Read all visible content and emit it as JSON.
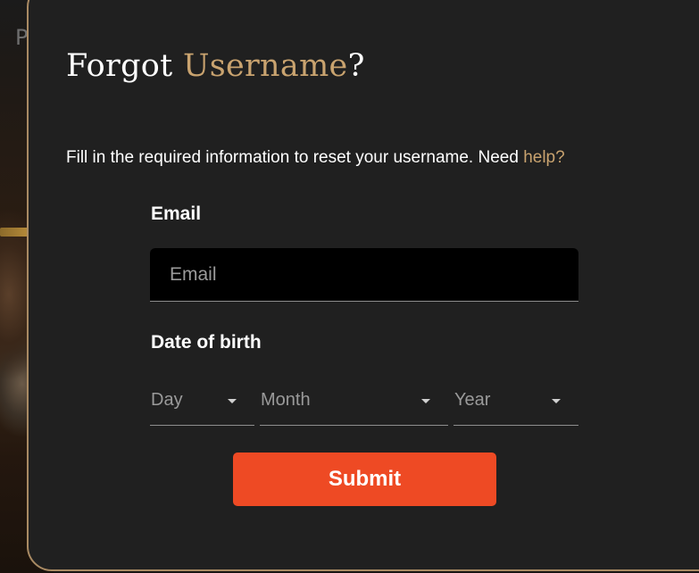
{
  "background": {
    "partial_text": "P"
  },
  "modal": {
    "title_part1": "Forgot ",
    "title_accent": "Username",
    "title_part2": "?",
    "description": "Fill in the required information to reset your username. Need ",
    "help_link": "help?"
  },
  "form": {
    "email_label": "Email",
    "email_placeholder": "Email",
    "email_value": "",
    "dob_label": "Date of birth",
    "day_selected": "Day",
    "month_selected": "Month",
    "year_selected": "Year",
    "submit_label": "Submit"
  },
  "colors": {
    "accent_gold": "#c9a36f",
    "submit_orange": "#ee4a24",
    "modal_bg": "#202020",
    "border_gold": "#a98a63"
  },
  "icons": {
    "select_caret": "caret-down-icon"
  }
}
